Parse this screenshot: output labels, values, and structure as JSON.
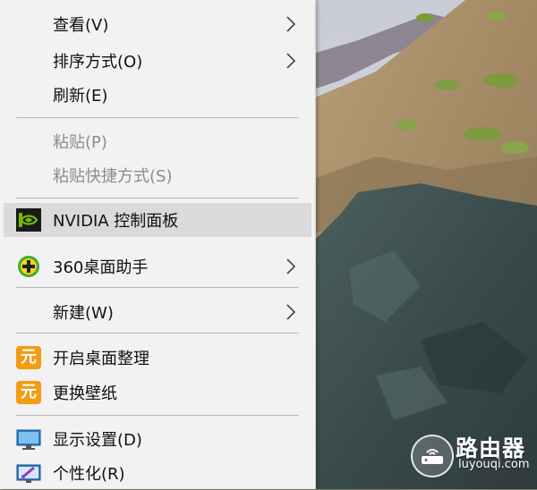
{
  "menu": {
    "items": [
      {
        "label": "查看(V)",
        "submenu": true,
        "enabled": true
      },
      {
        "label": "排序方式(O)",
        "submenu": true,
        "enabled": true
      },
      {
        "label": "刷新(E)",
        "submenu": false,
        "enabled": true
      },
      {
        "label": "粘贴(P)",
        "submenu": false,
        "enabled": false
      },
      {
        "label": "粘贴快捷方式(S)",
        "submenu": false,
        "enabled": false
      },
      {
        "label": "NVIDIA 控制面板",
        "submenu": false,
        "enabled": true,
        "icon": "nvidia-icon",
        "highlighted": true
      },
      {
        "label": "360桌面助手",
        "submenu": true,
        "enabled": true,
        "icon": "360-icon"
      },
      {
        "label": "新建(W)",
        "submenu": true,
        "enabled": true
      },
      {
        "label": "开启桌面整理",
        "submenu": false,
        "enabled": true,
        "icon": "yuan-icon"
      },
      {
        "label": "更换壁纸",
        "submenu": false,
        "enabled": true,
        "icon": "yuan-icon"
      },
      {
        "label": "显示设置(D)",
        "submenu": false,
        "enabled": true,
        "icon": "monitor-icon"
      },
      {
        "label": "个性化(R)",
        "submenu": false,
        "enabled": true,
        "icon": "personalize-icon"
      }
    ],
    "yuan_glyph": "元"
  },
  "watermark": {
    "title": "路由器",
    "subtitle": "luyouqi.com"
  },
  "colors": {
    "menu_bg": "#f2f2f2",
    "highlight_bg": "#dadada",
    "disabled_text": "#8c8c8c",
    "nvidia_green": "#76b900",
    "icon_360_green": "#3fae2a",
    "icon_360_yellow": "#f6d21c",
    "yuan_orange": "#f39c12",
    "monitor_blue": "#2b7bd1"
  }
}
